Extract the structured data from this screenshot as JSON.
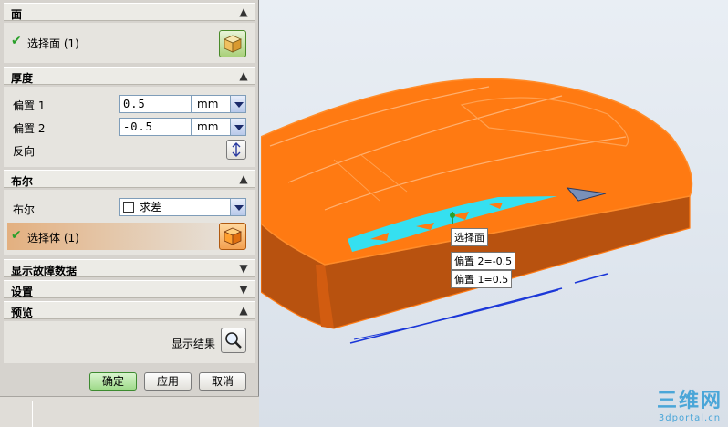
{
  "sections": {
    "face": {
      "title": "面",
      "select_label": "选择面 (1)"
    },
    "thickness": {
      "title": "厚度",
      "offset1": {
        "label": "偏置 1",
        "value": "0.5",
        "unit": "mm"
      },
      "offset2": {
        "label": "偏置 2",
        "value": "-0.5",
        "unit": "mm"
      },
      "reverse_label": "反向"
    },
    "boolean": {
      "title": "布尔",
      "label": "布尔",
      "selected": "求差",
      "select_body_label": "选择体 (1)"
    },
    "diagnostics": {
      "title": "显示故障数据"
    },
    "settings": {
      "title": "设置"
    },
    "preview": {
      "title": "预览",
      "show_result_label": "显示结果"
    }
  },
  "buttons": {
    "ok": "确定",
    "apply": "应用",
    "cancel": "取消"
  },
  "viewport": {
    "tooltip_face": "选择面",
    "tooltip_offset2": "偏置 2=-0.5",
    "tooltip_offset1": "偏置 1=0.5"
  },
  "watermark": {
    "logo": "三维网",
    "site": "3dportal.cn"
  },
  "colors": {
    "model_orange": "#ff7a12",
    "selection_cyan": "#35e0f0",
    "accent_green": "#2aa02a"
  }
}
